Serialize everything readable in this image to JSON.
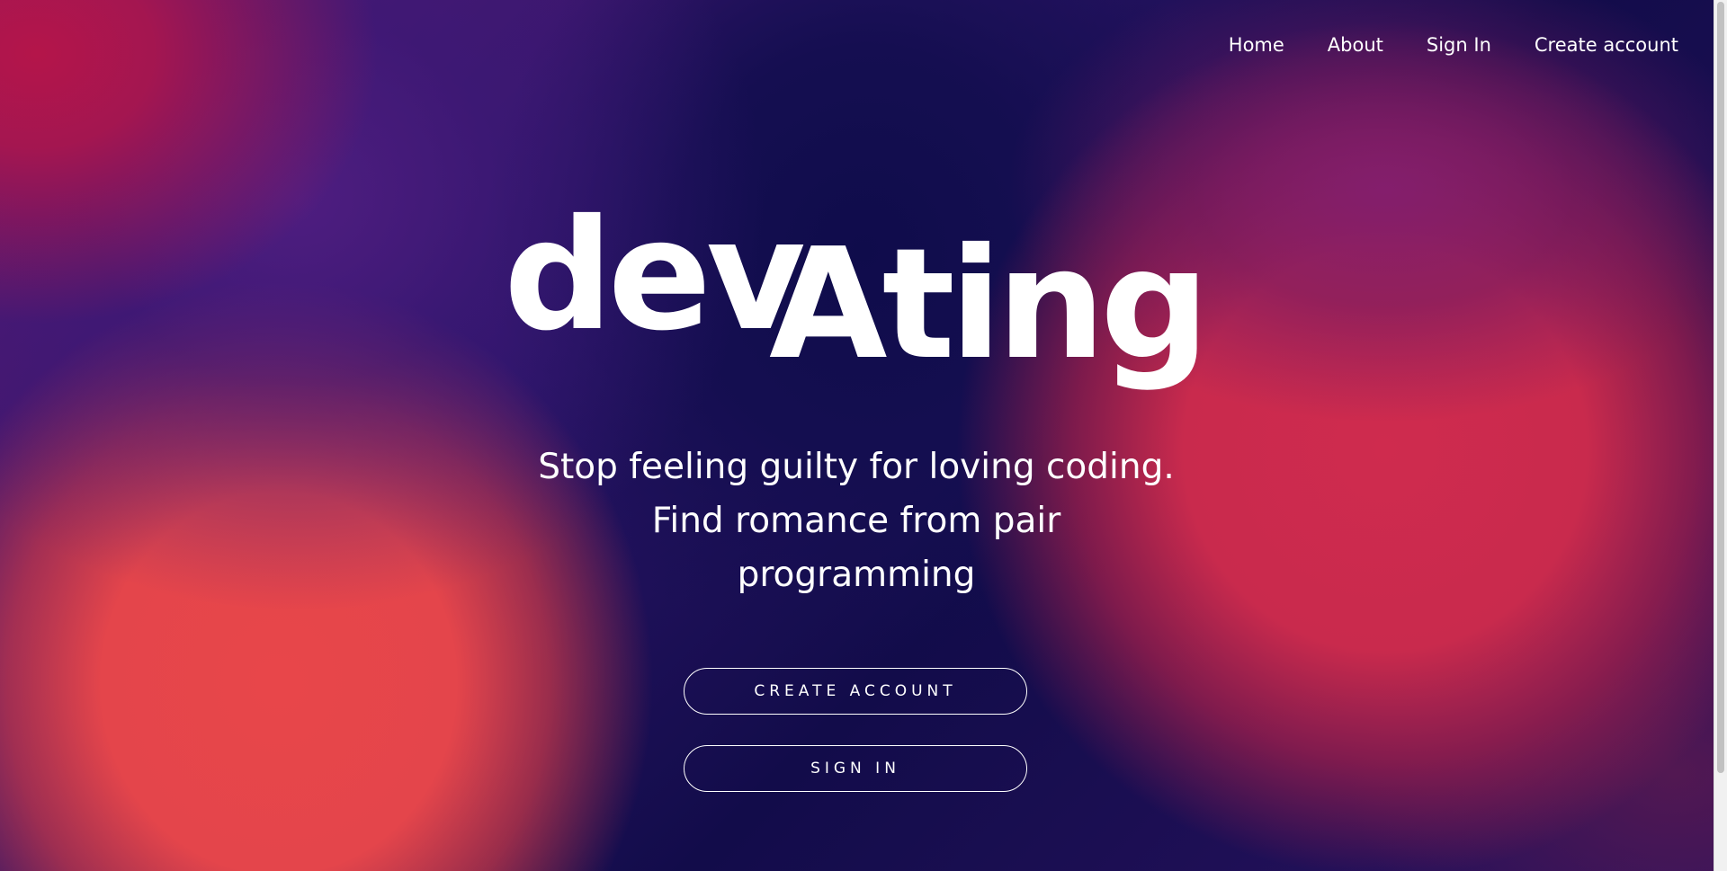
{
  "nav": {
    "items": [
      {
        "label": "Home"
      },
      {
        "label": "About"
      },
      {
        "label": "Sign In"
      },
      {
        "label": "Create account"
      }
    ]
  },
  "hero": {
    "logo_part1": "dev",
    "logo_part2": "Ating",
    "tagline_line1": "Stop feeling guilty for loving coding.",
    "tagline_line2": "Find romance from pair",
    "tagline_line3": "programming"
  },
  "buttons": {
    "create_account": "CREATE ACCOUNT",
    "sign_in": "SIGN IN"
  },
  "colors": {
    "text": "#ffffff",
    "deep_navy": "#120c4a",
    "coral": "#e4454b",
    "crimson": "#c92a4d",
    "magenta": "#b4154a"
  }
}
